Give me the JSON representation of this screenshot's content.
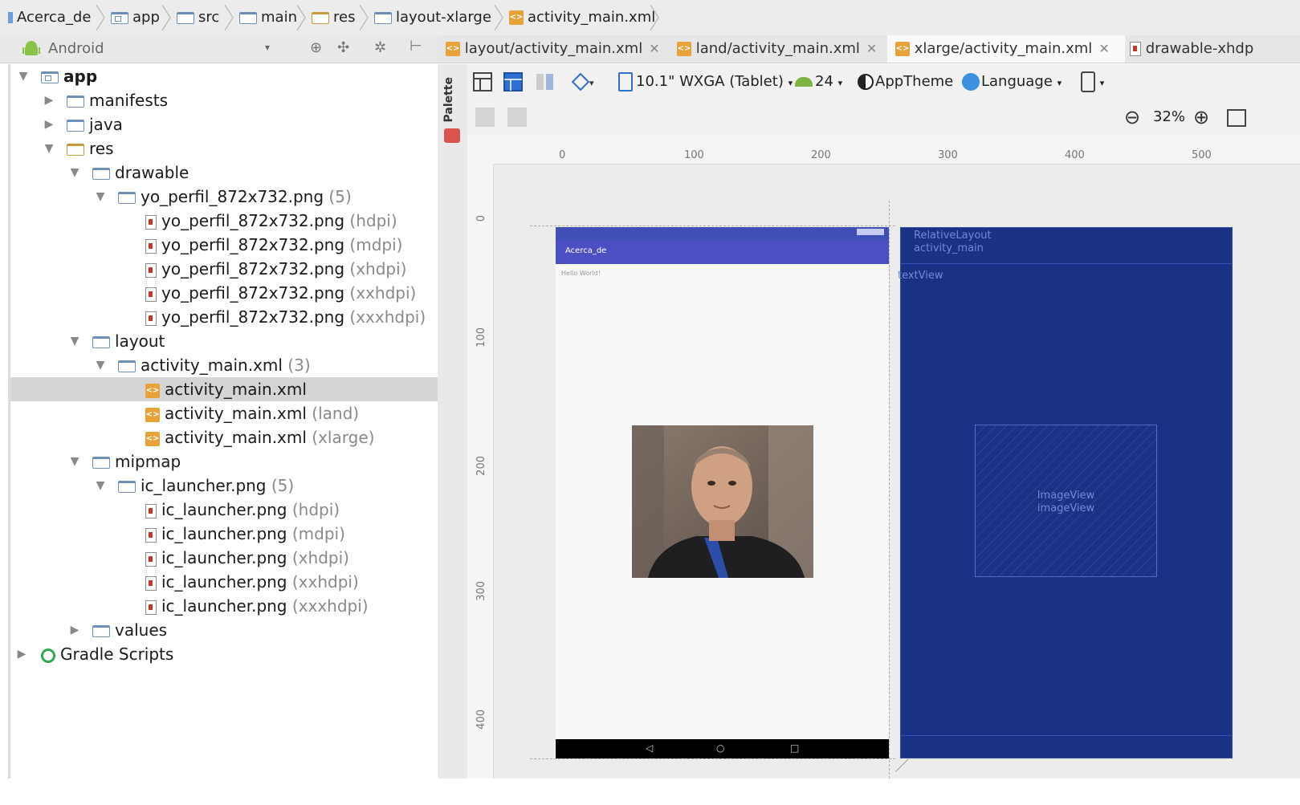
{
  "breadcrumb": [
    {
      "label": "Acerca_de",
      "icon": "module-icon"
    },
    {
      "label": "app",
      "icon": "folder-icon"
    },
    {
      "label": "src",
      "icon": "folder-icon"
    },
    {
      "label": "main",
      "icon": "folder-icon"
    },
    {
      "label": "res",
      "icon": "res-folder-icon"
    },
    {
      "label": "layout-xlarge",
      "icon": "folder-icon"
    },
    {
      "label": "activity_main.xml",
      "icon": "xml-file-icon"
    }
  ],
  "project_view": {
    "selector_label": "Android"
  },
  "tree": {
    "app": "app",
    "manifests": "manifests",
    "java": "java",
    "res": "res",
    "drawable": "drawable",
    "yo_group": "yo_perfil_872x732.png",
    "yo_group_count": "(5)",
    "yo_files": [
      {
        "name": "yo_perfil_872x732.png",
        "qual": "(hdpi)"
      },
      {
        "name": "yo_perfil_872x732.png",
        "qual": "(mdpi)"
      },
      {
        "name": "yo_perfil_872x732.png",
        "qual": "(xhdpi)"
      },
      {
        "name": "yo_perfil_872x732.png",
        "qual": "(xxhdpi)"
      },
      {
        "name": "yo_perfil_872x732.png",
        "qual": "(xxxhdpi)"
      }
    ],
    "layout": "layout",
    "act_group": "activity_main.xml",
    "act_group_count": "(3)",
    "act_files": [
      {
        "name": "activity_main.xml",
        "qual": ""
      },
      {
        "name": "activity_main.xml",
        "qual": "(land)"
      },
      {
        "name": "activity_main.xml",
        "qual": "(xlarge)"
      }
    ],
    "mipmap": "mipmap",
    "ic_group": "ic_launcher.png",
    "ic_group_count": "(5)",
    "ic_files": [
      {
        "name": "ic_launcher.png",
        "qual": "(hdpi)"
      },
      {
        "name": "ic_launcher.png",
        "qual": "(mdpi)"
      },
      {
        "name": "ic_launcher.png",
        "qual": "(xhdpi)"
      },
      {
        "name": "ic_launcher.png",
        "qual": "(xxhdpi)"
      },
      {
        "name": "ic_launcher.png",
        "qual": "(xxxhdpi)"
      }
    ],
    "values": "values",
    "gradle": "Gradle Scripts"
  },
  "editor_tabs": [
    {
      "label": "layout/activity_main.xml",
      "active": false
    },
    {
      "label": "land/activity_main.xml",
      "active": false
    },
    {
      "label": "xlarge/activity_main.xml",
      "active": true
    },
    {
      "label": "drawable-xhdp",
      "active": false
    }
  ],
  "palette_label": "Palette",
  "toolbar": {
    "device": "10.1\" WXGA (Tablet)",
    "api": "24",
    "theme": "AppTheme",
    "language": "Language",
    "zoom": "32%"
  },
  "ruler": {
    "h": [
      "0",
      "100",
      "200",
      "300",
      "400",
      "500"
    ],
    "v": [
      "0",
      "100",
      "200",
      "300",
      "400"
    ]
  },
  "device_preview": {
    "app_title": "Acerca_de",
    "text_view": "Hello World!"
  },
  "blueprint": {
    "root_line1": "RelativeLayout",
    "root_line2": "activity_main",
    "textview": "textView",
    "image_line1": "ImageView",
    "image_line2": "imageView"
  }
}
